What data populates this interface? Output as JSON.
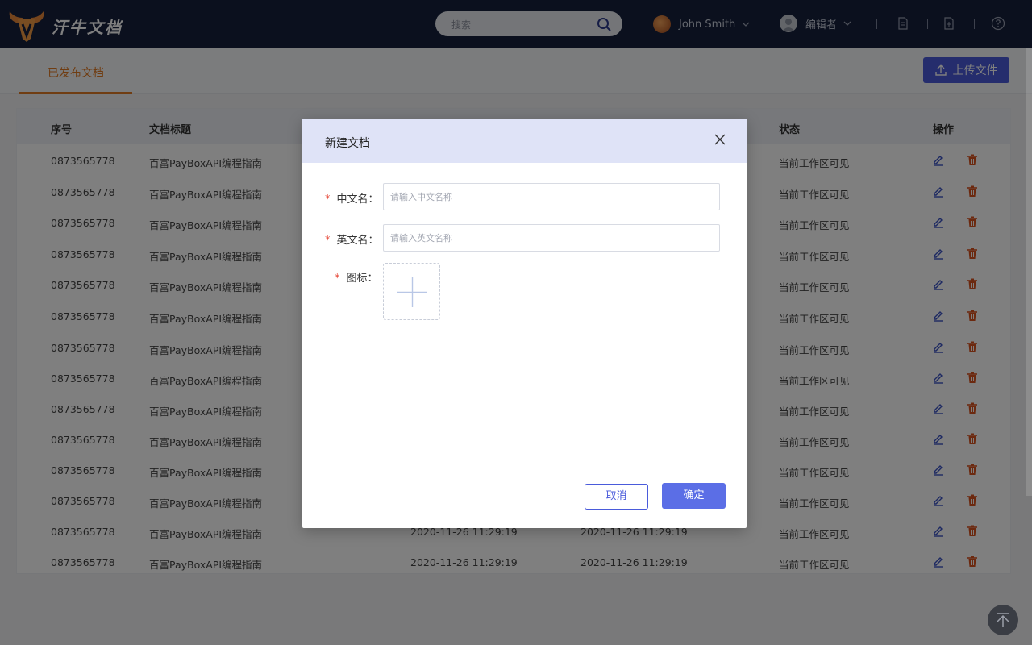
{
  "header": {
    "brand": "汗牛文档",
    "search_placeholder": "搜索",
    "user_name": "John Smith",
    "role": "编辑者"
  },
  "tabs": [
    {
      "label": "已发布文档"
    }
  ],
  "toolbar": {
    "upload_label": "上传文件"
  },
  "table": {
    "columns": {
      "index": "序号",
      "title": "文档标题",
      "status": "状态",
      "actions": "操作"
    },
    "rows": [
      {
        "id": "0873565778",
        "title": "百富PayBoxAPI编程指南",
        "created": "",
        "updated": "",
        "status": "当前工作区可见"
      },
      {
        "id": "0873565778",
        "title": "百富PayBoxAPI编程指南",
        "created": "",
        "updated": "",
        "status": "当前工作区可见"
      },
      {
        "id": "0873565778",
        "title": "百富PayBoxAPI编程指南",
        "created": "",
        "updated": "",
        "status": "当前工作区可见"
      },
      {
        "id": "0873565778",
        "title": "百富PayBoxAPI编程指南",
        "created": "",
        "updated": "",
        "status": "当前工作区可见"
      },
      {
        "id": "0873565778",
        "title": "百富PayBoxAPI编程指南",
        "created": "",
        "updated": "",
        "status": "当前工作区可见"
      },
      {
        "id": "0873565778",
        "title": "百富PayBoxAPI编程指南",
        "created": "",
        "updated": "",
        "status": "当前工作区可见"
      },
      {
        "id": "0873565778",
        "title": "百富PayBoxAPI编程指南",
        "created": "",
        "updated": "",
        "status": "当前工作区可见"
      },
      {
        "id": "0873565778",
        "title": "百富PayBoxAPI编程指南",
        "created": "",
        "updated": "",
        "status": "当前工作区可见"
      },
      {
        "id": "0873565778",
        "title": "百富PayBoxAPI编程指南",
        "created": "",
        "updated": "",
        "status": "当前工作区可见"
      },
      {
        "id": "0873565778",
        "title": "百富PayBoxAPI编程指南",
        "created": "",
        "updated": "",
        "status": "当前工作区可见"
      },
      {
        "id": "0873565778",
        "title": "百富PayBoxAPI编程指南",
        "created": "",
        "updated": "",
        "status": "当前工作区可见"
      },
      {
        "id": "0873565778",
        "title": "百富PayBoxAPI编程指南",
        "created": "",
        "updated": "",
        "status": "当前工作区可见"
      },
      {
        "id": "0873565778",
        "title": "百富PayBoxAPI编程指南",
        "created": "2020-11-26    11:29:19",
        "updated": "2020-11-26    11:29:19",
        "status": "当前工作区可见"
      },
      {
        "id": "0873565778",
        "title": "百富PayBoxAPI编程指南",
        "created": "2020-11-26    11:29:19",
        "updated": "2020-11-26    11:29:19",
        "status": "当前工作区可见"
      }
    ]
  },
  "modal": {
    "title": "新建文档",
    "fields": {
      "cn_label": "中文名：",
      "cn_placeholder": "请输入中文名称",
      "en_label": "英文名：",
      "en_placeholder": "请输入英文名称",
      "icon_label": "图标："
    },
    "required_mark": "*",
    "cancel_label": "取消",
    "confirm_label": "确定"
  },
  "colors": {
    "header_bg": "#16203c",
    "accent_orange": "#e07b25",
    "primary_blue": "#4a5bdb",
    "delete_red": "#d9531e"
  },
  "icons": [
    "logo-bull-icon",
    "search-icon",
    "chevron-down-icon",
    "document-icon",
    "add-document-icon",
    "help-icon",
    "upload-icon",
    "edit-icon",
    "delete-icon",
    "close-icon",
    "plus-icon",
    "back-to-top-icon"
  ]
}
